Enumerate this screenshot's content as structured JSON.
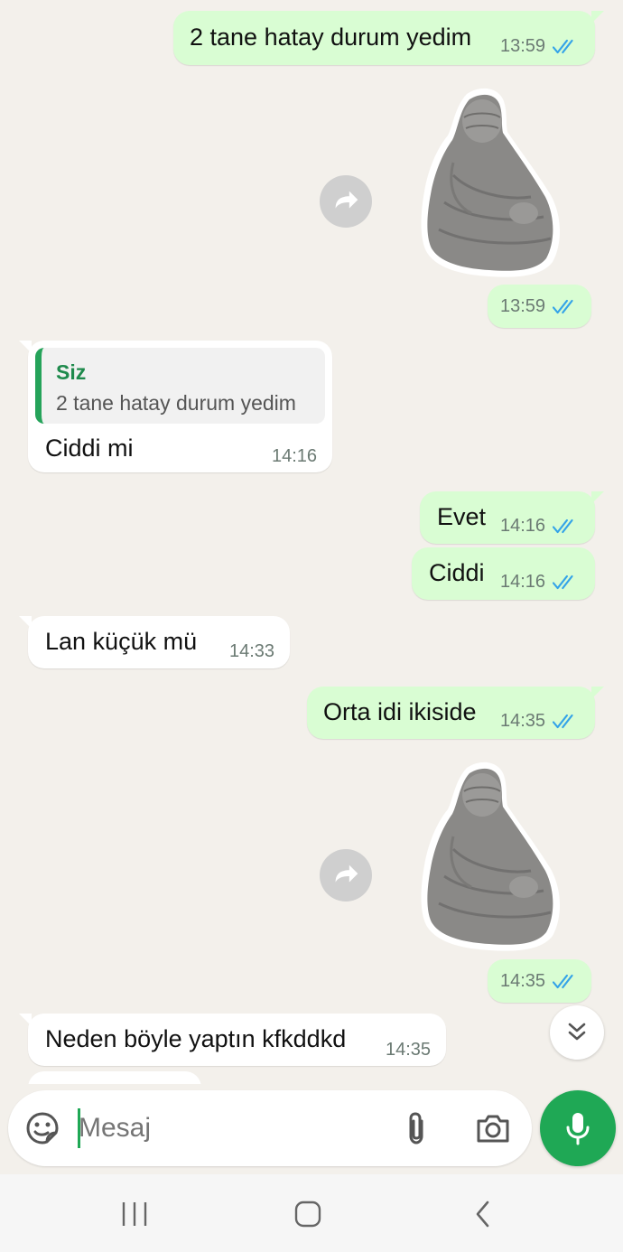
{
  "messages": [
    {
      "dir": "out",
      "text": "2 tane hatay durum yedim",
      "time": "13:59"
    },
    {
      "dir": "out",
      "type": "sticker",
      "time": "13:59"
    },
    {
      "dir": "in",
      "quote_name": "Siz",
      "quote_text": "2 tane hatay durum yedim",
      "text": "Ciddi mi",
      "time": "14:16"
    },
    {
      "dir": "out",
      "text": "Evet",
      "time": "14:16"
    },
    {
      "dir": "out",
      "text": "Ciddi",
      "time": "14:16"
    },
    {
      "dir": "in",
      "text": "Lan küçük mü",
      "time": "14:33"
    },
    {
      "dir": "out",
      "text": "Orta idi ikiside",
      "time": "14:35"
    },
    {
      "dir": "out",
      "type": "sticker",
      "time": "14:35"
    },
    {
      "dir": "in",
      "text": "Neden böyle yaptın kfkddkd",
      "time": "14:35"
    }
  ],
  "composer": {
    "placeholder": "Mesaj"
  },
  "icons": {
    "emoji": "sticker-emoji-icon",
    "attach": "paperclip-icon",
    "camera": "camera-icon",
    "mic": "microphone-icon",
    "forward": "forward-arrow-icon",
    "scroll_down": "double-chevron-down-icon",
    "read_receipt": "double-check-icon"
  },
  "colors": {
    "background": "#f3f0eb",
    "outgoing_bubble": "#d9fdd3",
    "incoming_bubble": "#ffffff",
    "accent": "#1fa855",
    "read_tick": "#34a3e8",
    "quote_name": "#1e8a4c"
  }
}
